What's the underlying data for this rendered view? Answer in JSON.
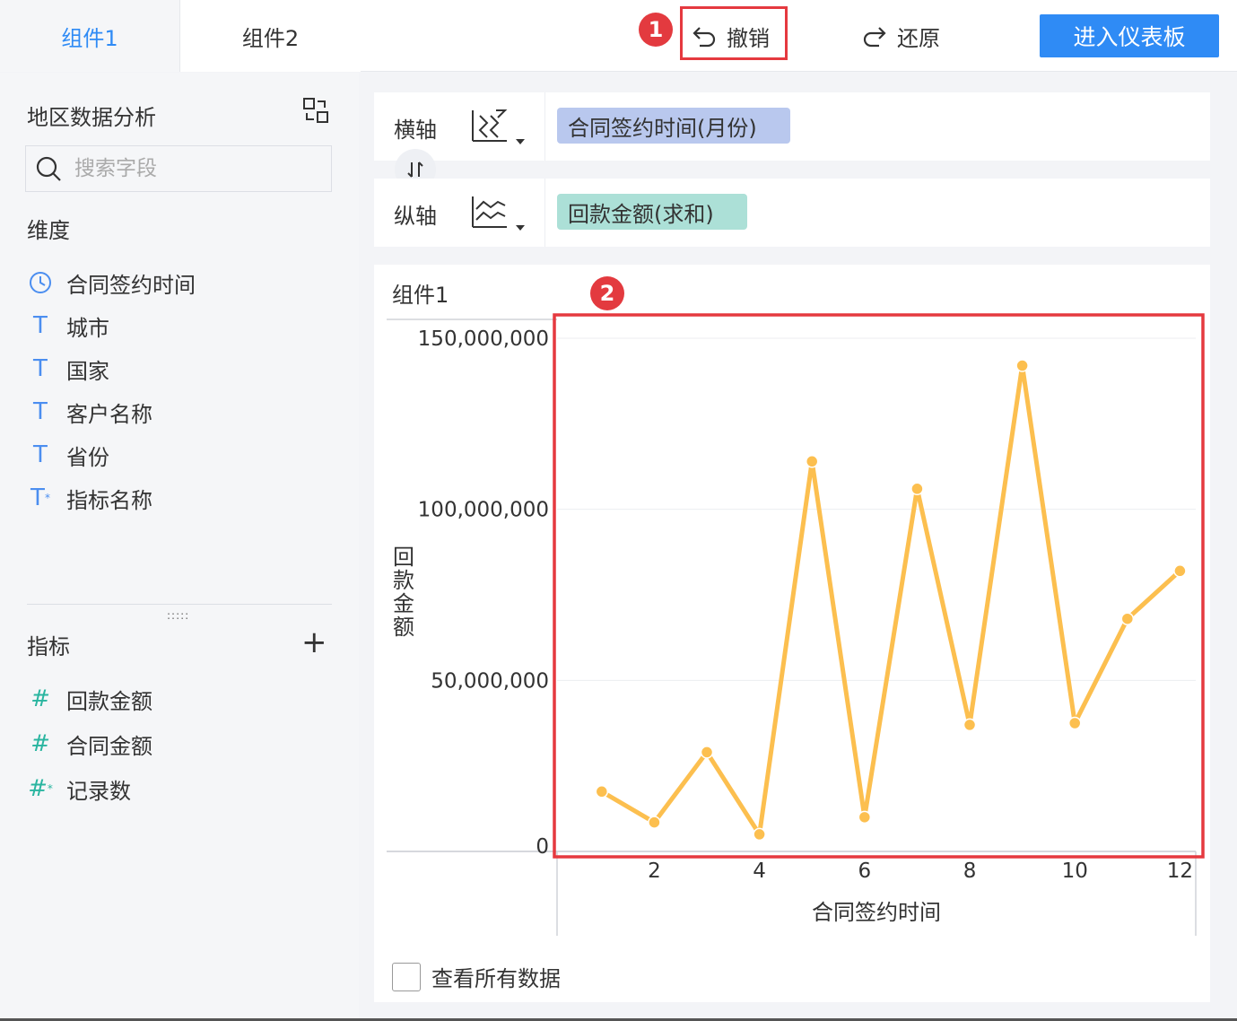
{
  "tabs": [
    {
      "label": "组件1",
      "active": true
    },
    {
      "label": "组件2",
      "active": false
    }
  ],
  "toolbar": {
    "undo_label": "撤销",
    "redo_label": "还原",
    "dashboard_label": "进入仪表板"
  },
  "badges": {
    "one": "1",
    "two": "2"
  },
  "left_panel": {
    "title": "地区数据分析",
    "search_placeholder": "搜索字段",
    "dimension_label": "维度",
    "dimensions": [
      {
        "icon": "clock-icon",
        "label": "合同签约时间"
      },
      {
        "icon": "T",
        "label": "城市"
      },
      {
        "icon": "T",
        "label": "国家"
      },
      {
        "icon": "T",
        "label": "客户名称"
      },
      {
        "icon": "T",
        "label": "省份"
      },
      {
        "icon": "T*",
        "label": "指标名称"
      }
    ],
    "measure_label": "指标",
    "measures": [
      {
        "icon": "#",
        "label": "回款金额"
      },
      {
        "icon": "#",
        "label": "合同金额"
      },
      {
        "icon": "#*",
        "label": "记录数"
      }
    ]
  },
  "axes": {
    "x_label": "横轴",
    "x_field": "合同签约时间(月份)",
    "y_label": "纵轴",
    "y_field": "回款金额(求和)"
  },
  "chart_card": {
    "title": "组件1",
    "checkbox_label": "查看所有数据"
  },
  "colors": {
    "accent": "#2f8bf5",
    "line": "#fcbf4f",
    "highlight": "#e5393f"
  },
  "chart_data": {
    "type": "line",
    "x": [
      1,
      2,
      3,
      4,
      5,
      6,
      7,
      8,
      9,
      10,
      11,
      12
    ],
    "series": [
      {
        "values": [
          17500000,
          8500000,
          29000000,
          5000000,
          114000000,
          10000000,
          106000000,
          37000000,
          142000000,
          37500000,
          68000000,
          82000000
        ]
      }
    ],
    "xlabel": "合同签约时间",
    "ylabel": "回款金额",
    "x_ticks": [
      "2",
      "4",
      "6",
      "8",
      "10",
      "12"
    ],
    "y_ticks": [
      "0",
      "50,000,000",
      "100,000,000",
      "150,000,000"
    ],
    "ylim": [
      0,
      150000000
    ],
    "grid": true
  }
}
